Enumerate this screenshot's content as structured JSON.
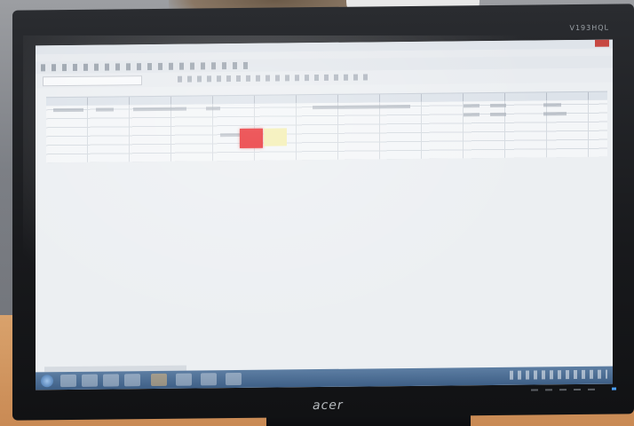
{
  "scene": {
    "monitor_brand": "acer",
    "monitor_model": "V193HQL"
  },
  "colors": {
    "highlight_red": "#e8262a",
    "highlight_yellow": "#f4eeb0",
    "taskbar": "#4b6b93",
    "screen_bg": "#eceff2"
  }
}
